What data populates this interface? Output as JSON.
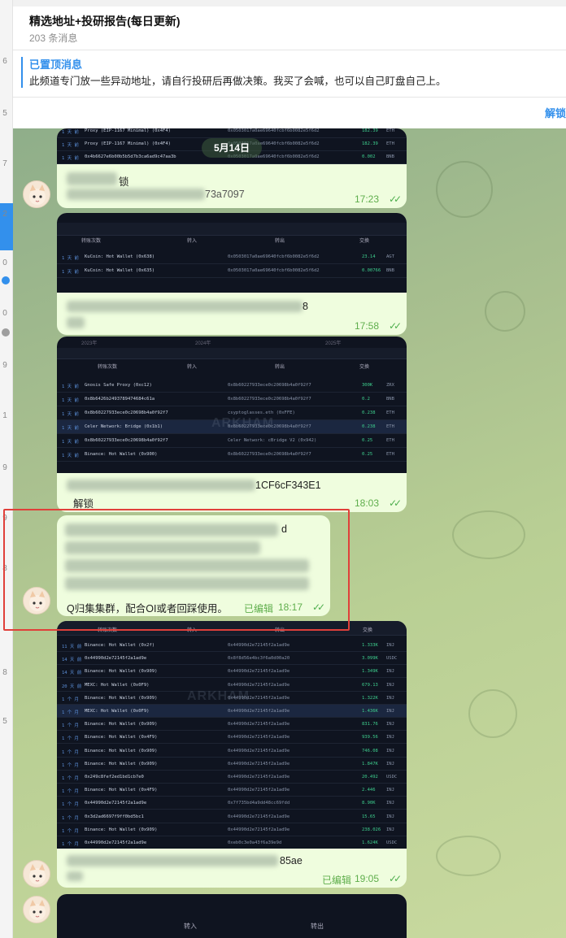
{
  "left_strip": {
    "numbers": [
      "6",
      "5",
      "7",
      "2",
      "0",
      "0",
      "9",
      "1",
      "9",
      "9",
      "8",
      "8",
      "5"
    ]
  },
  "header": {
    "title": "精选地址+投研报告(每日更新)",
    "subtitle": "203 条消息"
  },
  "pinned": {
    "title": "已置顶消息",
    "text": "此频道专门放一些异动地址，请自行投研后再做决策。我买了会喊，也可以自己盯盘自己上。"
  },
  "unlock_label": "解锁",
  "date_pill": "5月14日",
  "messages": [
    {
      "shot_rows": [
        [
          "1 天 前",
          "Proxy (EIP-1167 Minimal) (0x4F4)",
          "0x0503017a0ae69640fcbf6b0082e5f6d2",
          "182.39",
          "ETH"
        ],
        [
          "1 天 前",
          "Proxy (EIP-1167 Minimal) (0x4F4)",
          "0x0503017a0ae69640fcbf6b0082e5f6d2",
          "182.39",
          "ETH"
        ],
        [
          "1 天 前",
          "0x4b6627e6b00b5b5d7b3ca6ad9c47aa3b",
          "0x0503017a0ae69640fcbf6b0082e5f6d2",
          "0.002",
          "BNB"
        ]
      ],
      "caption_visible": "锁",
      "caption_tail": "73a7097",
      "time": "17:23"
    },
    {
      "shot_tabs": [
        "转账次数",
        "转入",
        "转出",
        "交换"
      ],
      "shot_rows": [
        [
          "1 天 前",
          "KuCoin: Hot Wallet (0x638)",
          "0x0503017a0ae69640fcbf6b0082e5f6d2",
          "23.14",
          "AGT"
        ],
        [
          "1 天 前",
          "KuCoin: Hot Wallet (0x635)",
          "0x0503017a0ae69640fcbf6b0082e5f6d2",
          "0.00766",
          "BNB"
        ]
      ],
      "caption_tail": "8",
      "time": "17:58"
    },
    {
      "shot_years": [
        "2023年",
        "2024年",
        "2025年"
      ],
      "shot_tabs": [
        "转账次数",
        "转入",
        "转出",
        "交换"
      ],
      "shot_rows": [
        [
          "1 天 前",
          "Gnosis Safe Proxy (0xc12)",
          "0x8b60227933ece0c20698b4a0f92f7",
          "300K",
          "ZRX"
        ],
        [
          "1 天 前",
          "0x8b6426b2493789474684c61a",
          "0x8b60227933ece0c20698b4a0f92f7",
          "0.2",
          "BNB"
        ],
        [
          "1 天 前",
          "0x8b60227933ece0c20698b4a0f92f7",
          "csyptoglasses.eth (0xFFE)",
          "0.238",
          "ETH"
        ],
        [
          "1 天 前",
          "Celer Network: Bridge (0x1b1)",
          "0x8b60227933ece0c20698b4a0f92f7",
          "0.238",
          "ETH"
        ],
        [
          "1 天 前",
          "0x8b60227933ece0c20698b4a0f92f7",
          "Celer Network: cBridge V2 (0x942)",
          "0.25",
          "ETH"
        ],
        [
          "1 天 前",
          "Binance: Hot Wallet (0x900)",
          "0x8b60227933ece0c20698b4a0f92f7",
          "0.25",
          "ETH"
        ]
      ],
      "watermark": "ARKHAM",
      "caption_tail": "1CF6cF343E1",
      "caption_line2": "解锁",
      "time": "18:03"
    },
    {
      "text_visible_1": "d",
      "text_last": "Q归集集群，配合OI或者回踩使用。",
      "edited": "已编辑",
      "time": "18:17"
    },
    {
      "shot_tabs": [
        "转账次数",
        "转入",
        "转出",
        "交换"
      ],
      "shot_rows": [
        [
          "11 天 前",
          "Binance: Hot Wallet (0x2f)",
          "0x44990d2e72145f2a1ad9e",
          "1.333K",
          "INJ"
        ],
        [
          "14 天 前",
          "0x44990d2e72145f2a1ad9e",
          "0x8f8d56e4bc3f6a0d00a20",
          "3.099K",
          "USDC"
        ],
        [
          "14 天 前",
          "Binance: Hot Wallet (0x909)",
          "0x44990d2e72145f2a1ad9e",
          "1.349K",
          "INJ"
        ],
        [
          "20 天 前",
          "MEXC: Hot Wallet (0x0F9)",
          "0x44990d2e72145f2a1ad9e",
          "679.13",
          "INJ"
        ],
        [
          "1 个 月",
          "Binance: Hot Wallet (0x909)",
          "0x44990d2e72145f2a1ad9e",
          "1.322K",
          "INJ"
        ],
        [
          "1 个 月",
          "MEXC: Hot Wallet (0x0F9)",
          "0x44990d2e72145f2a1ad9e",
          "1.436K",
          "INJ"
        ],
        [
          "1 个 月",
          "Binance: Hot Wallet (0x909)",
          "0x44990d2e72145f2a1ad9e",
          "831.76",
          "INJ"
        ],
        [
          "1 个 月",
          "Binance: Hot Wallet (0x4F9)",
          "0x44990d2e72145f2a1ad9e",
          "939.56",
          "INJ"
        ],
        [
          "1 个 月",
          "Binance: Hot Wallet (0x909)",
          "0x44990d2e72145f2a1ad9e",
          "746.08",
          "INJ"
        ],
        [
          "1 个 月",
          "Binance: Hot Wallet (0x909)",
          "0x44990d2e72145f2a1ad9e",
          "1.847K",
          "INJ"
        ],
        [
          "1 个 月",
          "0x249c8fef2ed1bd1cb7e0",
          "0x44990d2e72145f2a1ad9e",
          "20.492",
          "USDC"
        ],
        [
          "1 个 月",
          "Binance: Hot Wallet (0x4F9)",
          "0x44990d2e72145f2a1ad9e",
          "2.446",
          "INJ"
        ],
        [
          "1 个 月",
          "0x44990d2e72145f2a1ad9e",
          "0x7f735bd4a9dd48cc69fdd",
          "8.90K",
          "INJ"
        ],
        [
          "1 个 月",
          "0x3d2ad6697f9ff0bd5bc1",
          "0x44990d2e72145f2a1ad9e",
          "15.65",
          "INJ"
        ],
        [
          "1 个 月",
          "Binance: Hot Wallet (0x909)",
          "0x44990d2e72145f2a1ad9e",
          "238.026",
          "INJ"
        ],
        [
          "1 个 月",
          "0x44990d2e72145f2a1ad9e",
          "0xeb0c3e0a43f6a39e9d",
          "1.624K",
          "USDC"
        ]
      ],
      "watermark": "ARKHAM",
      "caption_tail": "85ae",
      "edited": "已编辑",
      "time": "19:05"
    },
    {
      "shot_tabs": [
        "转入",
        "转出"
      ]
    }
  ],
  "colors": {
    "accent": "#3390ec",
    "bubble": "#effdde",
    "time_green": "#5fae4c",
    "highlight_frame": "#e0403a"
  }
}
